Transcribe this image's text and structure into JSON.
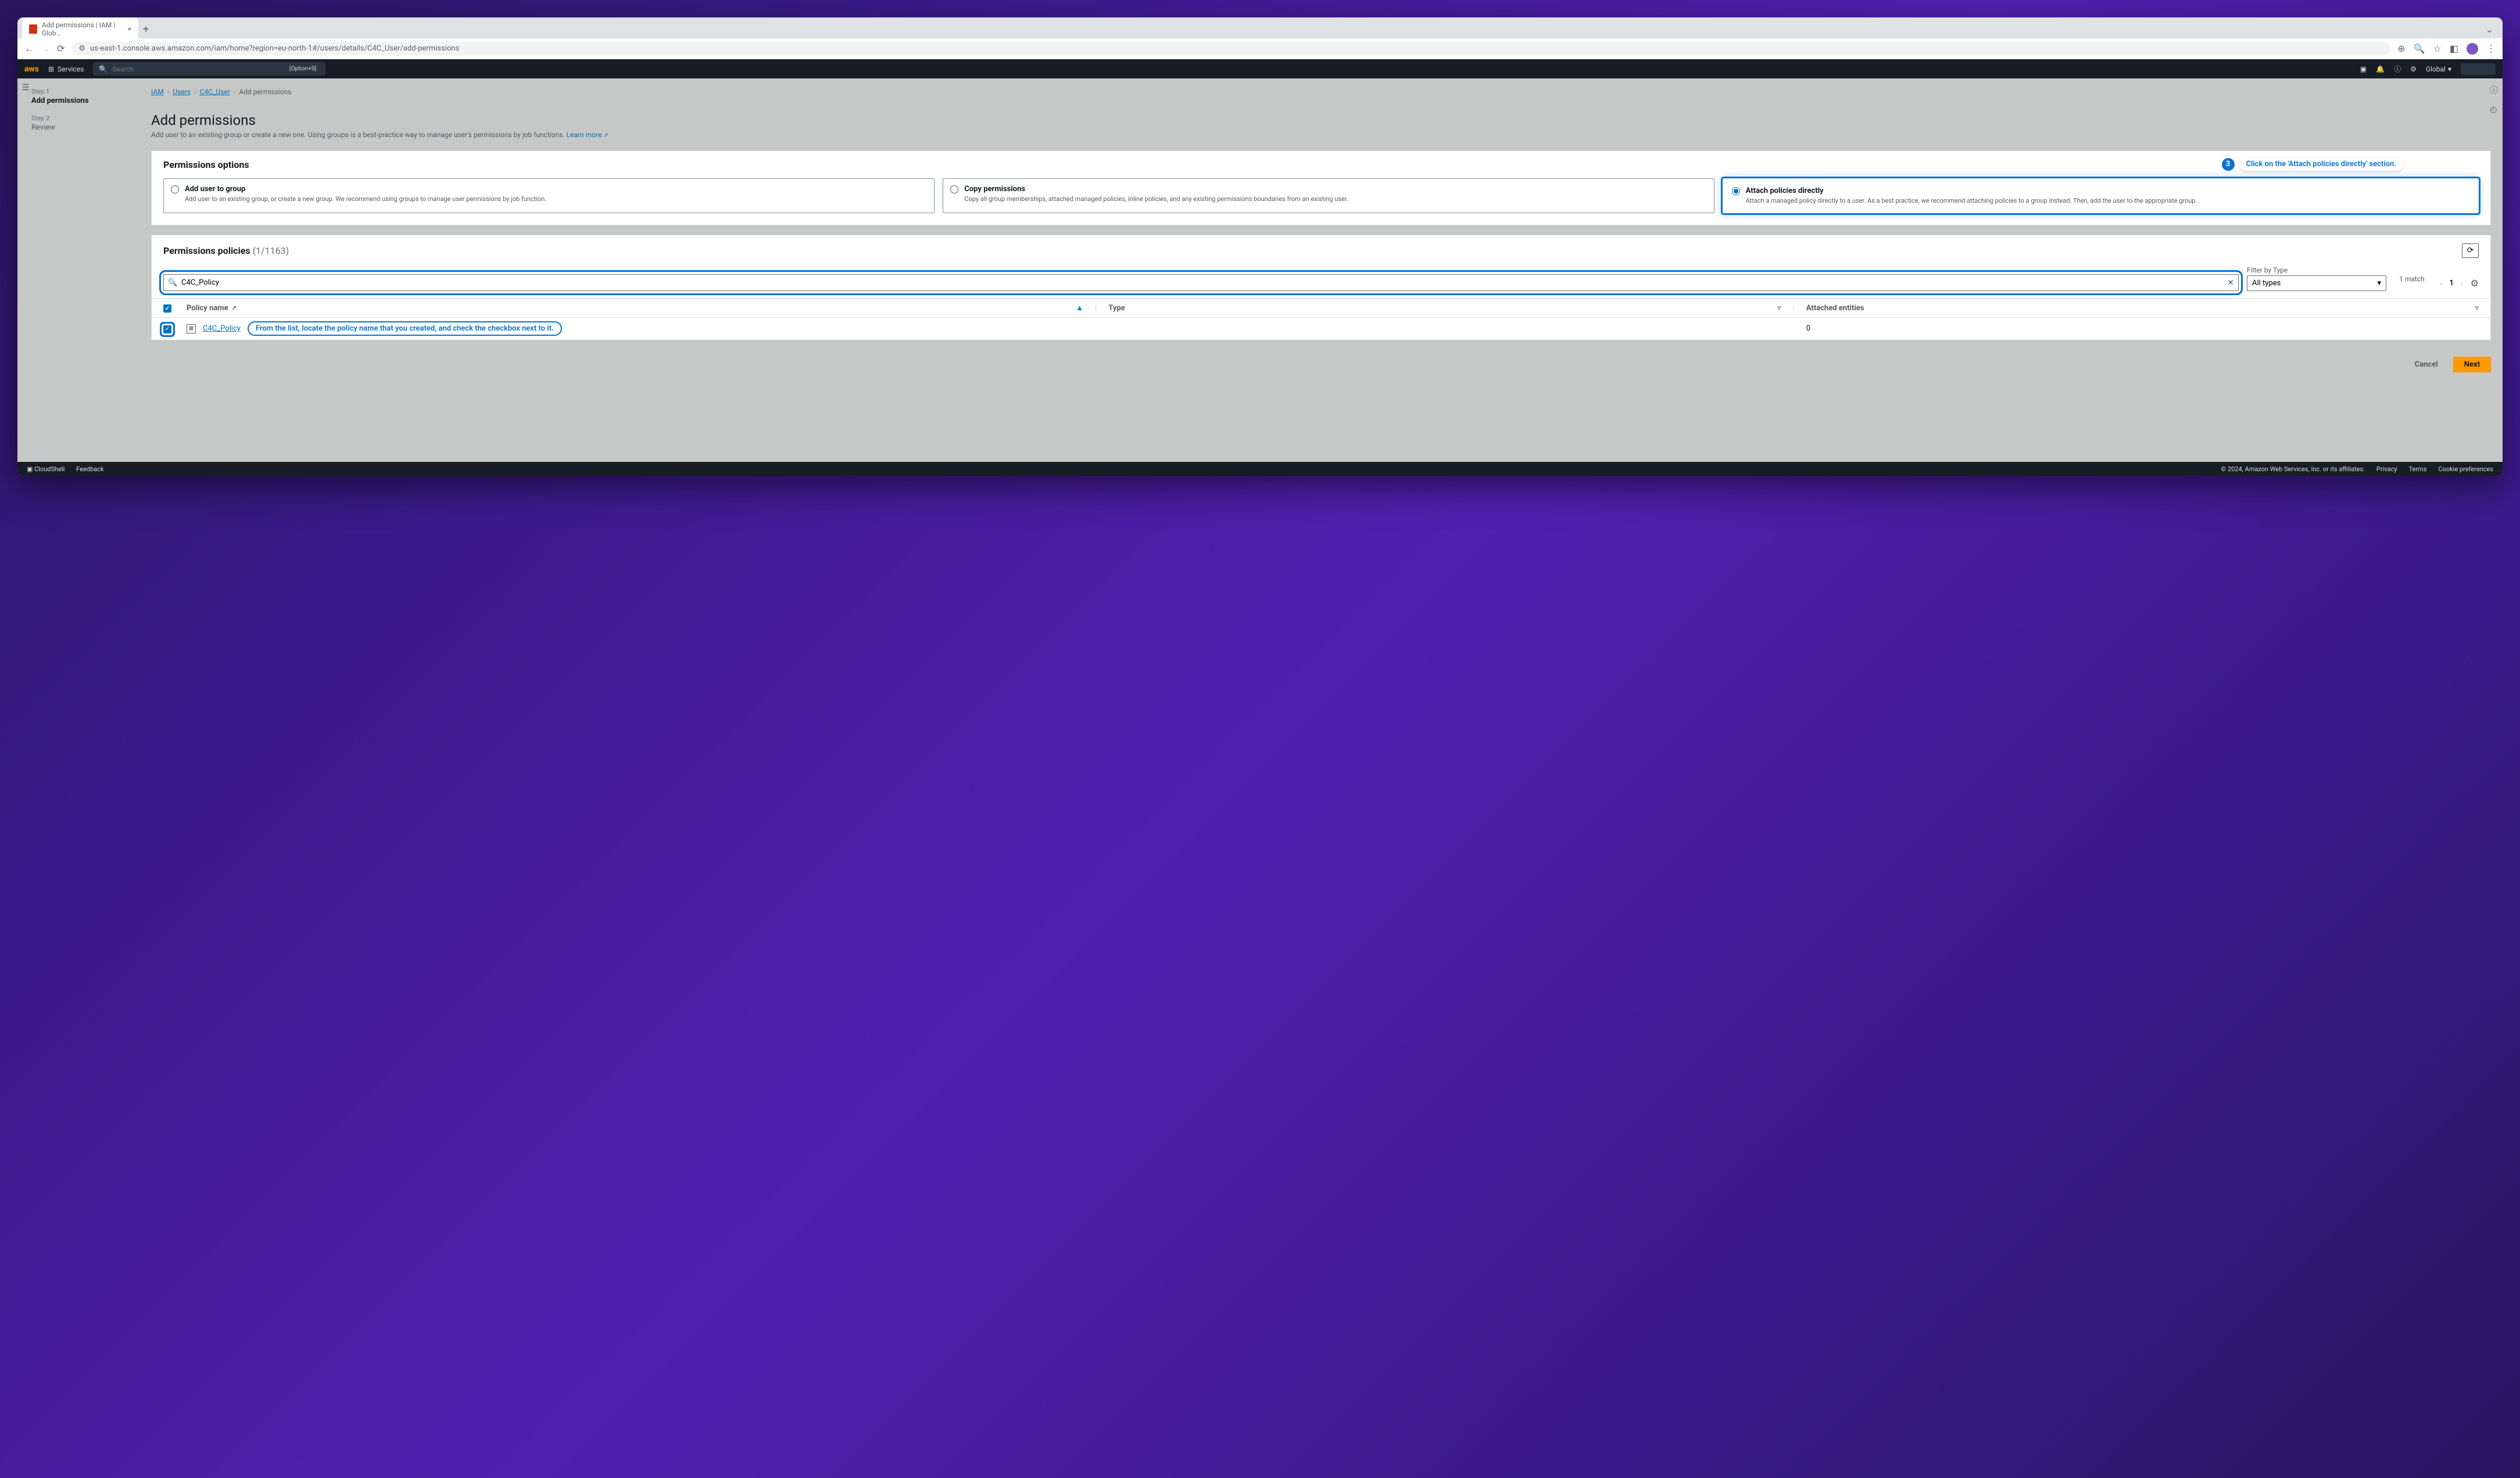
{
  "browser": {
    "tab_title": "Add permissions | IAM | Glob…",
    "url": "us-east-1.console.aws.amazon.com/iam/home?region=eu-north-1#/users/details/C4C_User/add-permissions"
  },
  "aws_header": {
    "services": "Services",
    "search_placeholder": "Search",
    "search_shortcut": "[Option+S]",
    "region": "Global"
  },
  "breadcrumb": {
    "iam": "IAM",
    "users": "Users",
    "user": "C4C_User",
    "current": "Add permissions"
  },
  "sidebar": {
    "step1_label": "Step 1",
    "step1_title": "Add permissions",
    "step2_label": "Step 2",
    "step2_title": "Review"
  },
  "page": {
    "title": "Add permissions",
    "desc": "Add user to an existing group or create a new one. Using groups is a best-practice way to manage user's permissions by job functions. ",
    "learn_more": "Learn more"
  },
  "options_panel": {
    "title": "Permissions options",
    "opt1_title": "Add user to group",
    "opt1_desc": "Add user to an existing group, or create a new group. We recommend using groups to manage user permissions by job function.",
    "opt2_title": "Copy permissions",
    "opt2_desc": "Copy all group memberships, attached managed policies, inline policies, and any existing permissions boundaries from an existing user.",
    "opt3_title": "Attach policies directly",
    "opt3_desc": "Attach a managed policy directly to a user. As a best practice, we recommend attaching policies to a group instead. Then, add the user to the appropriate group."
  },
  "callouts": {
    "c3_num": "3",
    "c3_text": "Click on the 'Attach policies directly' section.",
    "row_text": "From the list, locate the policy name that you created, and check the checkbox next to it."
  },
  "policies": {
    "title": "Permissions policies",
    "count": "(1/1163)",
    "filter_label": "Filter by Type",
    "filter_value": "All types",
    "search_value": "C4C_Policy",
    "match": "1 match",
    "page": "1",
    "col_name": "Policy name",
    "col_type": "Type",
    "col_entities": "Attached entities",
    "row_policy": "C4C_Policy",
    "row_entities": "0"
  },
  "buttons": {
    "cancel": "Cancel",
    "next": "Next"
  },
  "footer": {
    "cloudshell": "CloudShell",
    "feedback": "Feedback",
    "copyright": "© 2024, Amazon Web Services, Inc. or its affiliates.",
    "privacy": "Privacy",
    "terms": "Terms",
    "cookie": "Cookie preferences"
  }
}
